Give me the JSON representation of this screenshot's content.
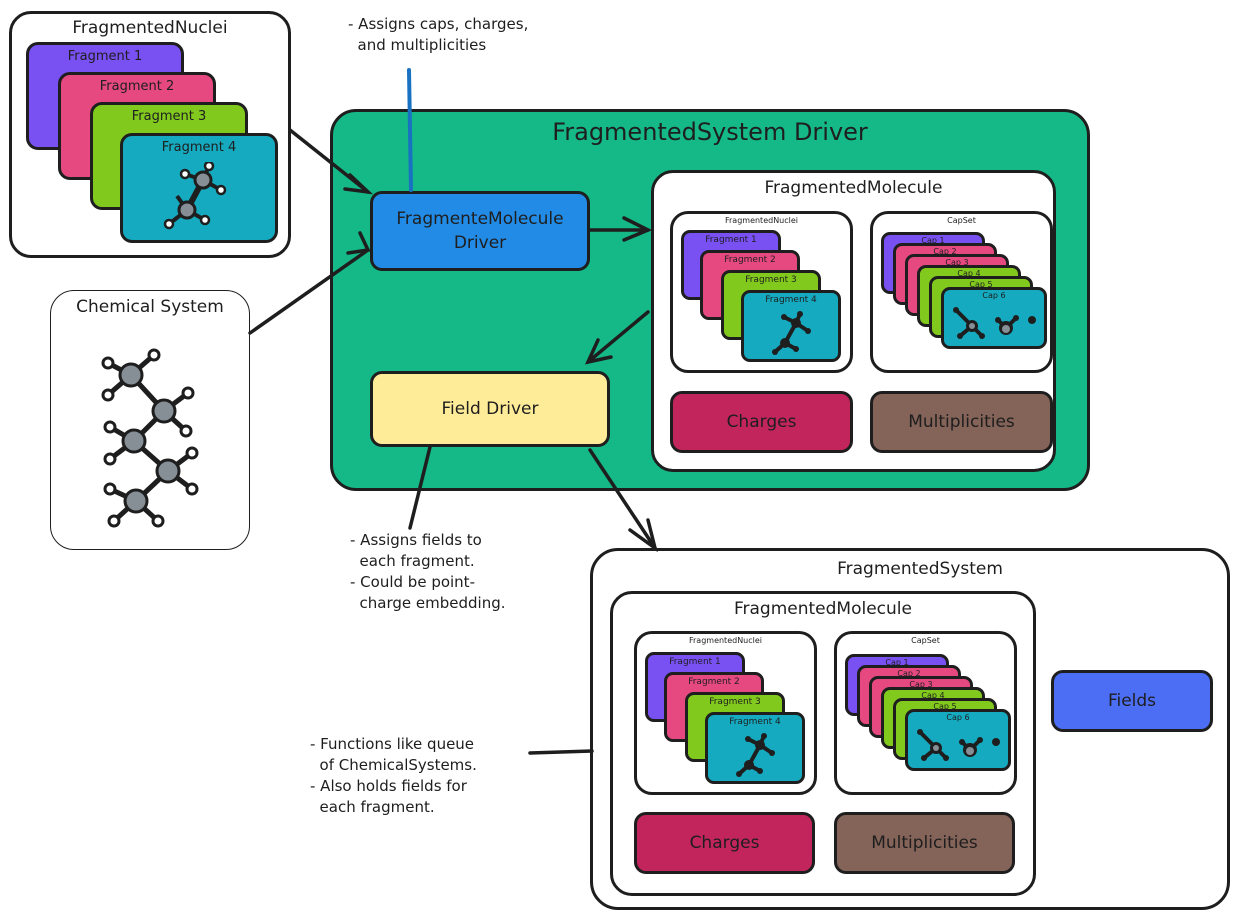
{
  "colors": {
    "driver_bg": "#15b887",
    "fm_driver": "#228be6",
    "field_driver": "#ffec99",
    "charges": "#c2255c",
    "multiplicities": "#846358",
    "fields": "#4c6ef5",
    "frag1": "#7950f2",
    "frag2": "#e64980",
    "frag3": "#82c91e",
    "frag4": "#15aabf",
    "note_line": "#1971c2",
    "atom": "#868e96"
  },
  "top_nuclei": {
    "title": "FragmentedNuclei",
    "fragments": [
      "Fragment 1",
      "Fragment 2",
      "Fragment 3",
      "Fragment 4"
    ]
  },
  "chemical_system": {
    "title": "Chemical System"
  },
  "driver": {
    "title": "FragmentedSystem Driver",
    "fm_driver_label": "FragmenteMolecule\nDriver",
    "field_driver_label": "Field Driver",
    "molecule": {
      "title": "FragmentedMolecule",
      "nuclei_title": "FragmentedNuclei",
      "fragments": [
        "Fragment 1",
        "Fragment 2",
        "Fragment 3",
        "Fragment 4"
      ],
      "capset_title": "CapSet",
      "caps": [
        "Cap 1",
        "Cap 2",
        "Cap 3",
        "Cap 4",
        "Cap 5",
        "Cap 6"
      ],
      "charges": "Charges",
      "multiplicities": "Multiplicities"
    }
  },
  "notes": {
    "fm_driver": "- Assigns caps, charges,\n  and multiplicities",
    "field_driver": "- Assigns fields to\n  each fragment.\n- Could be point-\n  charge embedding.",
    "system": "- Functions like queue\n  of ChemicalSystems.\n- Also holds fields for\n  each fragment."
  },
  "system": {
    "title": "FragmentedSystem",
    "molecule": {
      "title": "FragmentedMolecule",
      "nuclei_title": "FragmentedNuclei",
      "fragments": [
        "Fragment 1",
        "Fragment 2",
        "Fragment 3",
        "Fragment 4"
      ],
      "capset_title": "CapSet",
      "caps": [
        "Cap 1",
        "Cap 2",
        "Cap 3",
        "Cap 4",
        "Cap 5",
        "Cap 6"
      ],
      "charges": "Charges",
      "multiplicities": "Multiplicities"
    },
    "fields": "Fields"
  }
}
